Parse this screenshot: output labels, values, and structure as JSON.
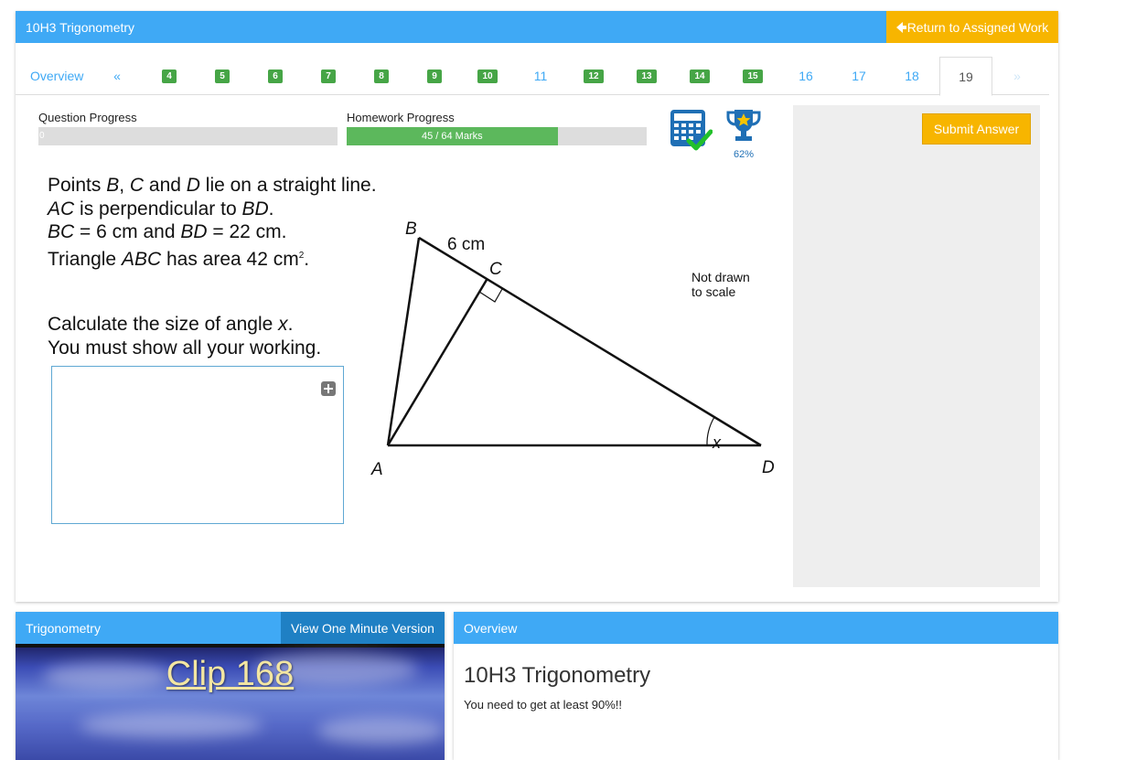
{
  "header": {
    "title": "10H3 Trigonometry",
    "return_label": "Return to Assigned Work"
  },
  "tabs": [
    {
      "label": "Overview",
      "type": "link"
    },
    {
      "label": "«",
      "type": "link"
    },
    {
      "label": "4",
      "type": "badge"
    },
    {
      "label": "5",
      "type": "badge"
    },
    {
      "label": "6",
      "type": "badge"
    },
    {
      "label": "7",
      "type": "badge"
    },
    {
      "label": "8",
      "type": "badge"
    },
    {
      "label": "9",
      "type": "badge"
    },
    {
      "label": "10",
      "type": "badge"
    },
    {
      "label": "11",
      "type": "link"
    },
    {
      "label": "12",
      "type": "badge"
    },
    {
      "label": "13",
      "type": "badge"
    },
    {
      "label": "14",
      "type": "badge"
    },
    {
      "label": "15",
      "type": "badge"
    },
    {
      "label": "16",
      "type": "link"
    },
    {
      "label": "17",
      "type": "link"
    },
    {
      "label": "18",
      "type": "link"
    },
    {
      "label": "19",
      "type": "active"
    },
    {
      "label": "»",
      "type": "disabled"
    }
  ],
  "progress": {
    "question_label": "Question Progress",
    "question_value": "0",
    "question_fraction": 0,
    "homework_label": "Homework Progress",
    "homework_text": "45 / 64 Marks",
    "homework_fraction": 0.703,
    "trophy_percent": "62%"
  },
  "icons": {
    "calculator": "calculator-check-icon",
    "trophy": "trophy-icon",
    "plus": "plus-icon",
    "arrow": "arrow-left-icon"
  },
  "colors": {
    "header_blue": "#3fa9f5",
    "accent_orange": "#f7b500",
    "badge_green": "#46a546",
    "progress_green": "#5cb85c"
  },
  "submit_label": "Submit Answer",
  "question": {
    "lines": [
      "Points B, C and D lie on a straight line.",
      "AC is perpendicular to BD.",
      "BC = 6 cm and BD = 22 cm.",
      "Triangle ABC has area 42 cm²."
    ],
    "instruction_1": "Calculate the size of angle x.",
    "instruction_2": "You must show all your working."
  },
  "diagram": {
    "label_B": "B",
    "label_C": "C",
    "label_A": "A",
    "label_D": "D",
    "label_x": "x",
    "length_BC": "6 cm",
    "note_line1": "Not drawn",
    "note_line2": "to scale"
  },
  "video_panel": {
    "title": "Trigonometry",
    "button_label": "View One Minute Version",
    "clip_label": "Clip 168"
  },
  "overview_panel": {
    "header": "Overview",
    "title": "10H3 Trigonometry",
    "text": "You need to get at least 90%!!"
  }
}
